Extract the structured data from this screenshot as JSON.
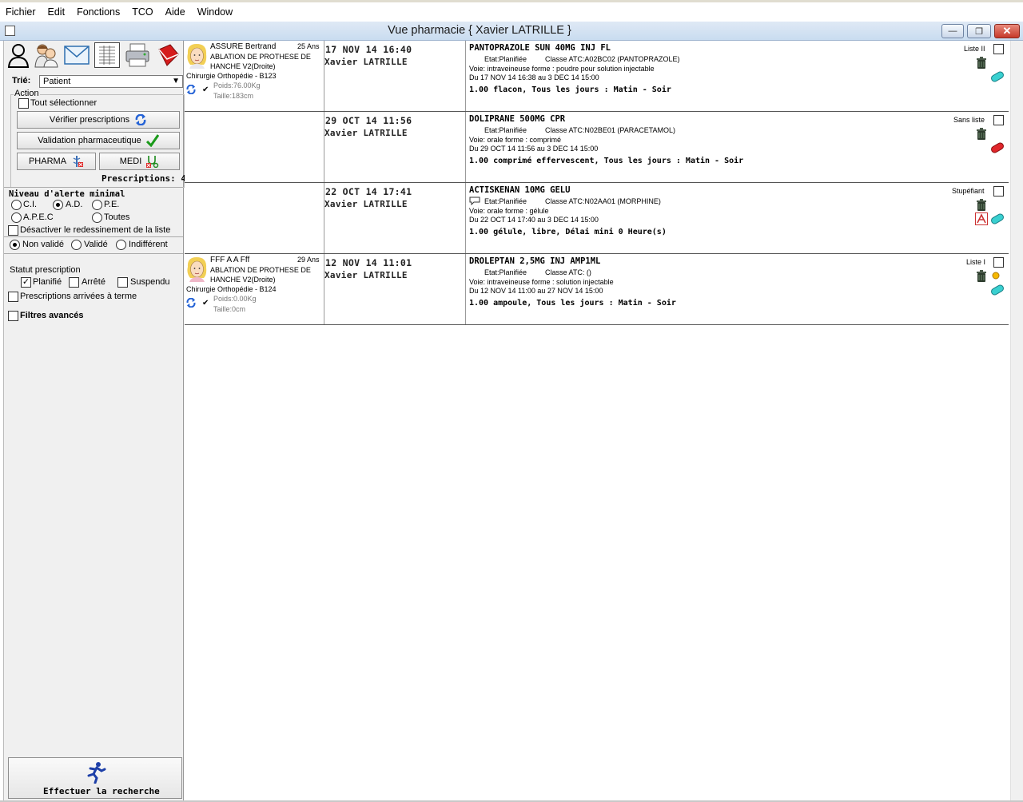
{
  "menu": [
    "Fichier",
    "Edit",
    "Fonctions",
    "TCO",
    "Aide",
    "Window"
  ],
  "window": {
    "title": "Vue pharmacie   { Xavier LATRILLE }",
    "minimize": "—",
    "restore": "❐",
    "close": "✕"
  },
  "toolbar": {
    "icons": [
      "person-silhouette-icon",
      "patient-group-icon",
      "mail-icon",
      "chart-document-icon",
      "printer-icon",
      "book-icon"
    ]
  },
  "filters": {
    "sort_label": "Trié:",
    "sort_value": "Patient",
    "action_label": "Action",
    "select_all": "Tout sélectionner",
    "verify_btn": "Vérifier prescriptions",
    "validate_btn": "Validation pharmaceutique",
    "pharma_btn": "PHARMA",
    "medi_btn": "MEDI",
    "prescriptions_count": "Prescriptions: 4",
    "alert_label": "Niveau d'alerte minimal",
    "alert_options": [
      "C.I.",
      "A.D.",
      "P.E.",
      "A.P.E.C",
      "Toutes"
    ],
    "alert_selected": "A.D.",
    "disable_resize": "Désactiver le redessinement de la liste",
    "validation_options": [
      "Non validé",
      "Validé",
      "Indifférent"
    ],
    "validation_selected": "Non validé",
    "status_label": "Statut prescription",
    "status_planifie": "Planifié",
    "status_arrete": "Arrêté",
    "status_suspendu": "Suspendu",
    "arrived_term": "Prescriptions arrivées à terme",
    "advanced": "Filtres avancés",
    "search_btn": "Effectuer la recherche"
  },
  "rows": [
    {
      "patient": {
        "name": "ASSURE Bertrand",
        "age": "25 Ans",
        "reason1": "ABLATION DE PROTHESE DE",
        "reason2": "HANCHE V2(Droite)",
        "service": "Chirurgie Orthopédie - B123",
        "weight": "Poids:76.00Kg",
        "height": "Taille:183cm"
      },
      "datetime": "17 NOV 14  16:40",
      "prescriber": "Xavier LATRILLE",
      "drug": "PANTOPRAZOLE SUN 40MG INJ FL",
      "state": "Etat:Planifiée",
      "atc": "Classe ATC:A02BC02  (PANTOPRAZOLE)",
      "route": "Voie: intraveineuse  forme : poudre pour solution injectable",
      "period": "Du 17 NOV 14  16:38 au 3 DEC 14  15:00",
      "posology": "1.00 flacon, Tous les jours : Matin - Soir",
      "list": "Liste II"
    },
    {
      "datetime": "29 OCT 14  11:56",
      "prescriber": "Xavier LATRILLE",
      "drug": "DOLIPRANE 500MG CPR",
      "state": "Etat:Planifiée",
      "atc": "Classe ATC:N02BE01  (PARACETAMOL)",
      "route": "Voie: orale  forme : comprimé",
      "period": "Du 29 OCT 14  11:56 au 3 DEC 14  15:00",
      "posology": "1.00 comprimé effervescent, Tous les jours : Matin - Soir",
      "list": "Sans liste"
    },
    {
      "datetime": "22 OCT 14  17:41",
      "prescriber": "Xavier LATRILLE",
      "drug": "ACTISKENAN 10MG GELU",
      "state": "Etat:Planifiée",
      "atc": "Classe ATC:N02AA01  (MORPHINE)",
      "route": "Voie: orale  forme : gélule",
      "period": "Du 22 OCT 14  17:40 au 3 DEC 14  15:00",
      "posology": "1.00 gélule, libre, Délai mini 0 Heure(s)",
      "list": "Stupéfiant"
    },
    {
      "patient": {
        "name": "FFF A A Fff",
        "age": "29 Ans",
        "reason1": "ABLATION DE PROTHESE DE",
        "reason2": "HANCHE V2(Droite)",
        "service": "Chirurgie Orthopédie - B124",
        "weight": "Poids:0.00Kg",
        "height": "Taille:0cm"
      },
      "datetime": "12 NOV 14  11:01",
      "prescriber": "Xavier LATRILLE",
      "drug": "DROLEPTAN 2,5MG INJ AMP1ML",
      "state": "Etat:Planifiée",
      "atc": "Classe ATC:  ()",
      "route": "Voie: intraveineuse  forme : solution injectable",
      "period": "Du 12 NOV 14  11:00 au 27 NOV 14  15:00",
      "posology": "1.00 ampoule, Tous les jours : Matin - Soir",
      "list": "Liste I"
    }
  ]
}
